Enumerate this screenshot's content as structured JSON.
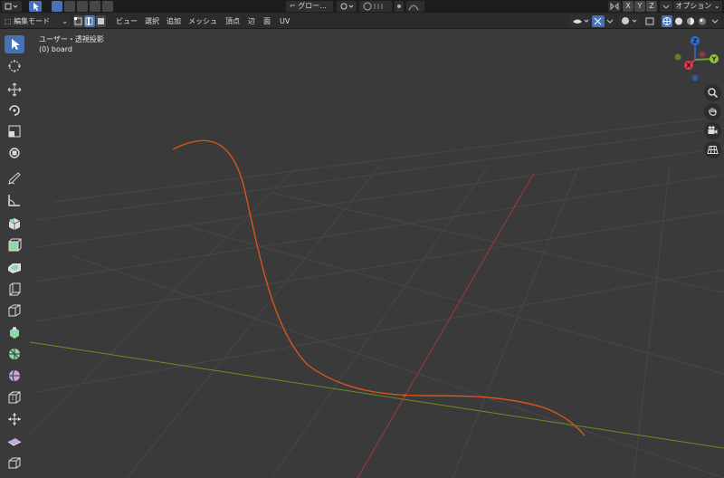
{
  "topbar": {
    "editor_type_icon": "3d-viewport-icon",
    "transform_orientation": "グロー...",
    "axis_x": "X",
    "axis_y": "Y",
    "axis_z": "Z",
    "options_label": "オプション"
  },
  "header": {
    "mode_label": "編集モード",
    "menus": [
      "ビュー",
      "選択",
      "追加",
      "メッシュ",
      "頂点",
      "辺",
      "面",
      "UV"
    ]
  },
  "viewport": {
    "view_name": "ユーザー・透視投影",
    "object_name": "(0) board",
    "gizmo": {
      "x": "X",
      "y": "Y",
      "z": "Z"
    }
  },
  "colors": {
    "x_axis": "#a13838",
    "y_axis": "#6f8b22",
    "curve": "#d9541c",
    "active": "#4772b3"
  }
}
